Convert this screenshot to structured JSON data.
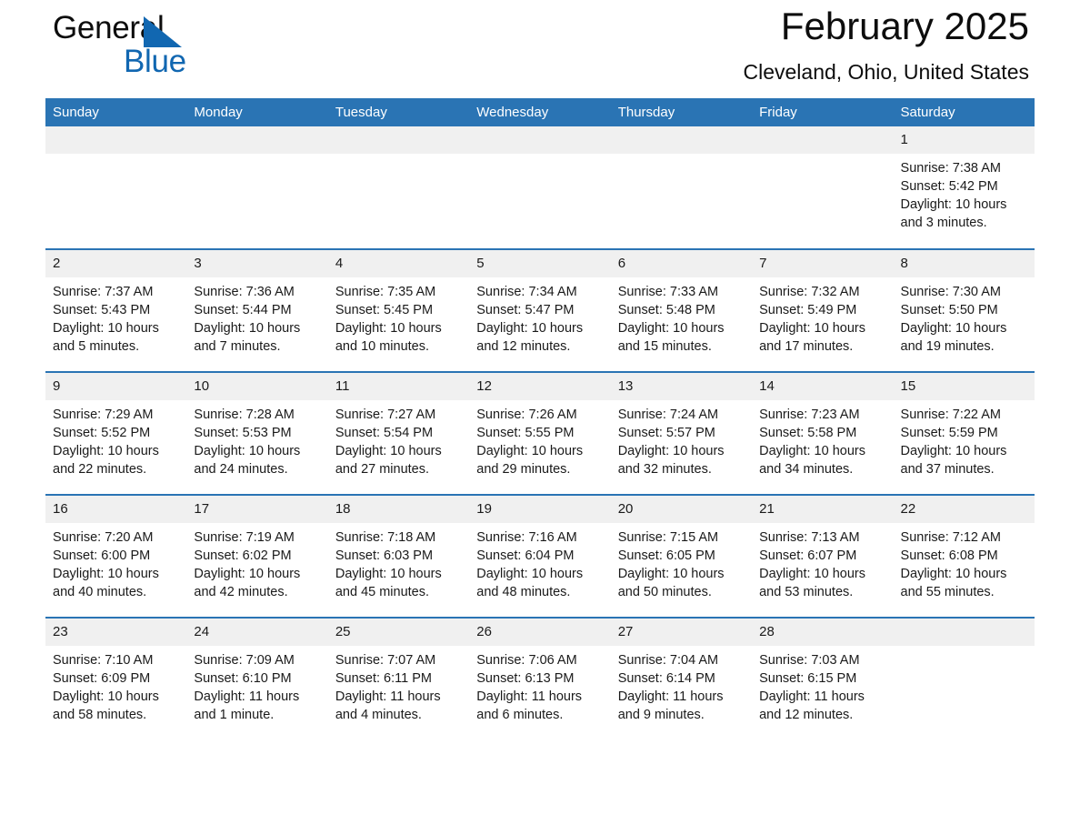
{
  "brand": {
    "name_top": "General",
    "name_bottom": "Blue",
    "triangle_color": "#1167b1",
    "text_color": "#0d0d0d"
  },
  "header": {
    "month_title": "February 2025",
    "location": "Cleveland, Ohio, United States"
  },
  "theme": {
    "header_blue": "#2a74b4",
    "daynum_gray": "#f0f0f0",
    "row_rule_blue": "#2a74b4",
    "text": "#1a1a1a"
  },
  "weekday_headers": [
    "Sunday",
    "Monday",
    "Tuesday",
    "Wednesday",
    "Thursday",
    "Friday",
    "Saturday"
  ],
  "weeks": [
    [
      {
        "day": "",
        "blank": true,
        "sunrise": "",
        "sunset": "",
        "daylight": ""
      },
      {
        "day": "",
        "blank": true,
        "sunrise": "",
        "sunset": "",
        "daylight": ""
      },
      {
        "day": "",
        "blank": true,
        "sunrise": "",
        "sunset": "",
        "daylight": ""
      },
      {
        "day": "",
        "blank": true,
        "sunrise": "",
        "sunset": "",
        "daylight": ""
      },
      {
        "day": "",
        "blank": true,
        "sunrise": "",
        "sunset": "",
        "daylight": ""
      },
      {
        "day": "",
        "blank": true,
        "sunrise": "",
        "sunset": "",
        "daylight": ""
      },
      {
        "day": "1",
        "blank": false,
        "sunrise": "Sunrise: 7:38 AM",
        "sunset": "Sunset: 5:42 PM",
        "daylight": "Daylight: 10 hours and 3 minutes."
      }
    ],
    [
      {
        "day": "2",
        "blank": false,
        "sunrise": "Sunrise: 7:37 AM",
        "sunset": "Sunset: 5:43 PM",
        "daylight": "Daylight: 10 hours and 5 minutes."
      },
      {
        "day": "3",
        "blank": false,
        "sunrise": "Sunrise: 7:36 AM",
        "sunset": "Sunset: 5:44 PM",
        "daylight": "Daylight: 10 hours and 7 minutes."
      },
      {
        "day": "4",
        "blank": false,
        "sunrise": "Sunrise: 7:35 AM",
        "sunset": "Sunset: 5:45 PM",
        "daylight": "Daylight: 10 hours and 10 minutes."
      },
      {
        "day": "5",
        "blank": false,
        "sunrise": "Sunrise: 7:34 AM",
        "sunset": "Sunset: 5:47 PM",
        "daylight": "Daylight: 10 hours and 12 minutes."
      },
      {
        "day": "6",
        "blank": false,
        "sunrise": "Sunrise: 7:33 AM",
        "sunset": "Sunset: 5:48 PM",
        "daylight": "Daylight: 10 hours and 15 minutes."
      },
      {
        "day": "7",
        "blank": false,
        "sunrise": "Sunrise: 7:32 AM",
        "sunset": "Sunset: 5:49 PM",
        "daylight": "Daylight: 10 hours and 17 minutes."
      },
      {
        "day": "8",
        "blank": false,
        "sunrise": "Sunrise: 7:30 AM",
        "sunset": "Sunset: 5:50 PM",
        "daylight": "Daylight: 10 hours and 19 minutes."
      }
    ],
    [
      {
        "day": "9",
        "blank": false,
        "sunrise": "Sunrise: 7:29 AM",
        "sunset": "Sunset: 5:52 PM",
        "daylight": "Daylight: 10 hours and 22 minutes."
      },
      {
        "day": "10",
        "blank": false,
        "sunrise": "Sunrise: 7:28 AM",
        "sunset": "Sunset: 5:53 PM",
        "daylight": "Daylight: 10 hours and 24 minutes."
      },
      {
        "day": "11",
        "blank": false,
        "sunrise": "Sunrise: 7:27 AM",
        "sunset": "Sunset: 5:54 PM",
        "daylight": "Daylight: 10 hours and 27 minutes."
      },
      {
        "day": "12",
        "blank": false,
        "sunrise": "Sunrise: 7:26 AM",
        "sunset": "Sunset: 5:55 PM",
        "daylight": "Daylight: 10 hours and 29 minutes."
      },
      {
        "day": "13",
        "blank": false,
        "sunrise": "Sunrise: 7:24 AM",
        "sunset": "Sunset: 5:57 PM",
        "daylight": "Daylight: 10 hours and 32 minutes."
      },
      {
        "day": "14",
        "blank": false,
        "sunrise": "Sunrise: 7:23 AM",
        "sunset": "Sunset: 5:58 PM",
        "daylight": "Daylight: 10 hours and 34 minutes."
      },
      {
        "day": "15",
        "blank": false,
        "sunrise": "Sunrise: 7:22 AM",
        "sunset": "Sunset: 5:59 PM",
        "daylight": "Daylight: 10 hours and 37 minutes."
      }
    ],
    [
      {
        "day": "16",
        "blank": false,
        "sunrise": "Sunrise: 7:20 AM",
        "sunset": "Sunset: 6:00 PM",
        "daylight": "Daylight: 10 hours and 40 minutes."
      },
      {
        "day": "17",
        "blank": false,
        "sunrise": "Sunrise: 7:19 AM",
        "sunset": "Sunset: 6:02 PM",
        "daylight": "Daylight: 10 hours and 42 minutes."
      },
      {
        "day": "18",
        "blank": false,
        "sunrise": "Sunrise: 7:18 AM",
        "sunset": "Sunset: 6:03 PM",
        "daylight": "Daylight: 10 hours and 45 minutes."
      },
      {
        "day": "19",
        "blank": false,
        "sunrise": "Sunrise: 7:16 AM",
        "sunset": "Sunset: 6:04 PM",
        "daylight": "Daylight: 10 hours and 48 minutes."
      },
      {
        "day": "20",
        "blank": false,
        "sunrise": "Sunrise: 7:15 AM",
        "sunset": "Sunset: 6:05 PM",
        "daylight": "Daylight: 10 hours and 50 minutes."
      },
      {
        "day": "21",
        "blank": false,
        "sunrise": "Sunrise: 7:13 AM",
        "sunset": "Sunset: 6:07 PM",
        "daylight": "Daylight: 10 hours and 53 minutes."
      },
      {
        "day": "22",
        "blank": false,
        "sunrise": "Sunrise: 7:12 AM",
        "sunset": "Sunset: 6:08 PM",
        "daylight": "Daylight: 10 hours and 55 minutes."
      }
    ],
    [
      {
        "day": "23",
        "blank": false,
        "sunrise": "Sunrise: 7:10 AM",
        "sunset": "Sunset: 6:09 PM",
        "daylight": "Daylight: 10 hours and 58 minutes."
      },
      {
        "day": "24",
        "blank": false,
        "sunrise": "Sunrise: 7:09 AM",
        "sunset": "Sunset: 6:10 PM",
        "daylight": "Daylight: 11 hours and 1 minute."
      },
      {
        "day": "25",
        "blank": false,
        "sunrise": "Sunrise: 7:07 AM",
        "sunset": "Sunset: 6:11 PM",
        "daylight": "Daylight: 11 hours and 4 minutes."
      },
      {
        "day": "26",
        "blank": false,
        "sunrise": "Sunrise: 7:06 AM",
        "sunset": "Sunset: 6:13 PM",
        "daylight": "Daylight: 11 hours and 6 minutes."
      },
      {
        "day": "27",
        "blank": false,
        "sunrise": "Sunrise: 7:04 AM",
        "sunset": "Sunset: 6:14 PM",
        "daylight": "Daylight: 11 hours and 9 minutes."
      },
      {
        "day": "28",
        "blank": false,
        "sunrise": "Sunrise: 7:03 AM",
        "sunset": "Sunset: 6:15 PM",
        "daylight": "Daylight: 11 hours and 12 minutes."
      },
      {
        "day": "",
        "blank": true,
        "sunrise": "",
        "sunset": "",
        "daylight": ""
      }
    ]
  ]
}
